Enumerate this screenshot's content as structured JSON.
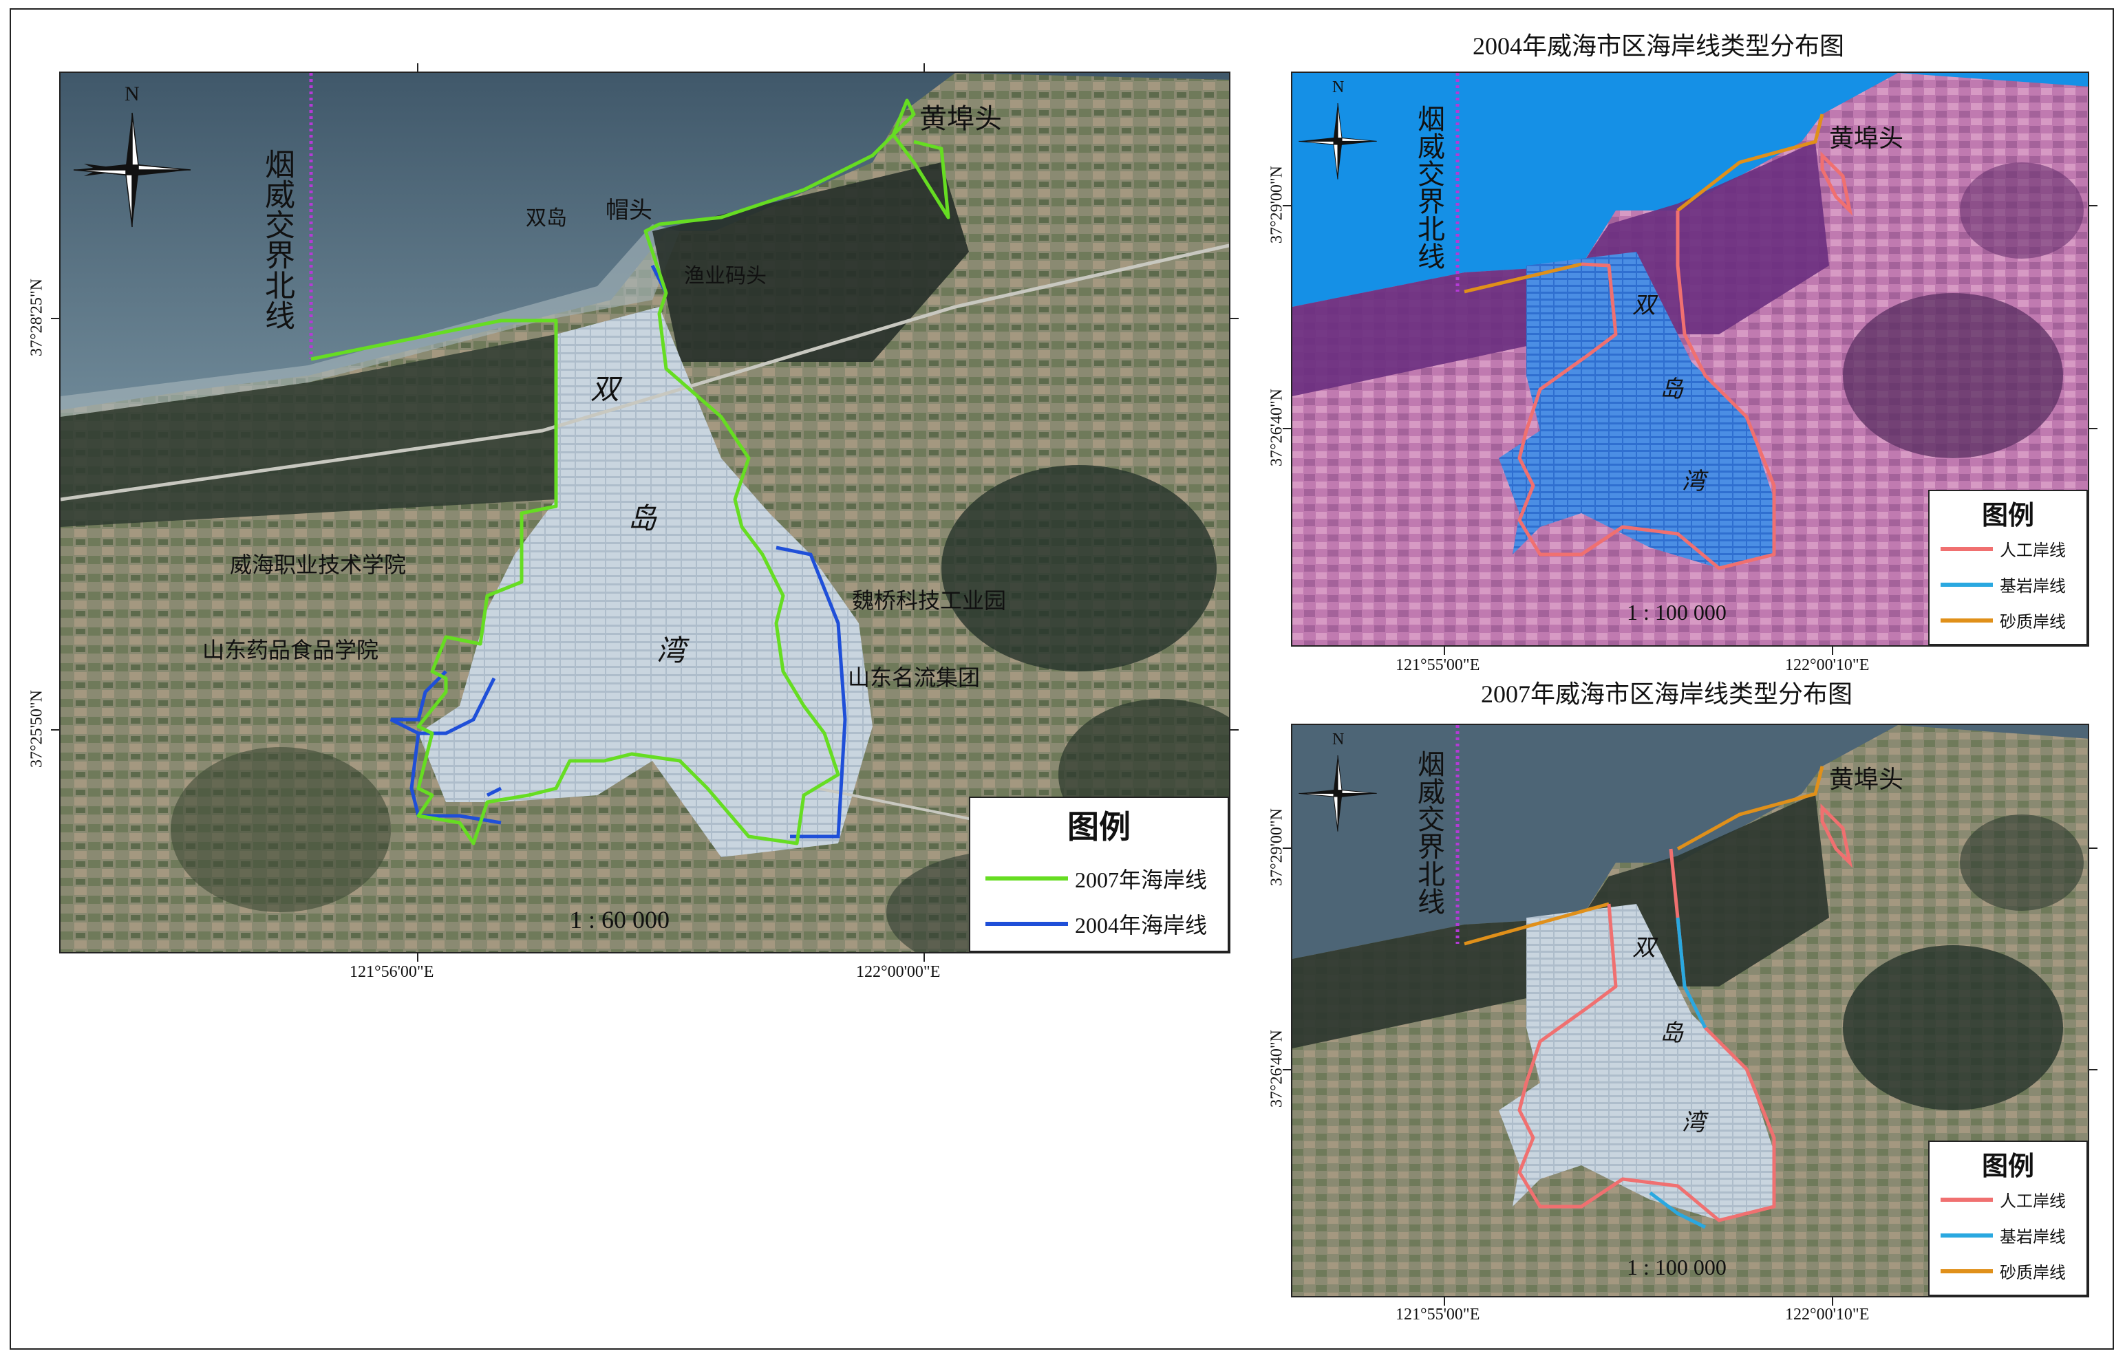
{
  "main_map": {
    "place_labels": {
      "huangbutou": "黄埠头",
      "shuangdao": "双岛",
      "maotou": "帽头",
      "yuye_matou": "渔业码头",
      "zhiye_xueyuan": "威海职业技术学院",
      "yaopin_xueyuan": "山东药品食品学院",
      "weiqiao": "魏桥科技工业园",
      "mingliu": "山东名流集团",
      "bay_char_1": "双",
      "bay_char_2": "岛",
      "bay_char_3": "湾"
    },
    "boundary_label": "烟威交界北线",
    "north_label": "N",
    "scale": "1 : 60 000",
    "legend": {
      "title": "图例",
      "items": [
        {
          "label": "2007年海岸线",
          "color": "#66dd22"
        },
        {
          "label": "2004年海岸线",
          "color": "#1f4fd8"
        }
      ]
    },
    "lat_labels": [
      "37°28'25\"N",
      "37°25'50\"N"
    ],
    "lon_labels": [
      "121°56'00\"E",
      "122°00'00\"E"
    ]
  },
  "map_2004": {
    "title": "2004年威海市区海岸线类型分布图",
    "place_labels": {
      "huangbutou": "黄埠头",
      "bay_char_1": "双",
      "bay_char_2": "岛",
      "bay_char_3": "湾"
    },
    "boundary_label": "烟威交界北线",
    "north_label": "N",
    "scale": "1 : 100 000",
    "legend": {
      "title": "图例",
      "items": [
        {
          "label": "人工岸线",
          "color": "#f07070"
        },
        {
          "label": "基岩岸线",
          "color": "#2aa8e0"
        },
        {
          "label": "砂质岸线",
          "color": "#e0901a"
        }
      ]
    },
    "lat_labels": [
      "37°29'00\"N",
      "37°26'40\"N"
    ],
    "lon_labels": [
      "121°55'00\"E",
      "122°00'10\"E"
    ]
  },
  "map_2007": {
    "title": "2007年威海市区海岸线类型分布图",
    "place_labels": {
      "huangbutou": "黄埠头",
      "bay_char_1": "双",
      "bay_char_2": "岛",
      "bay_char_3": "湾"
    },
    "boundary_label": "烟威交界北线",
    "north_label": "N",
    "scale": "1 : 100 000",
    "legend": {
      "title": "图例",
      "items": [
        {
          "label": "人工岸线",
          "color": "#f07070"
        },
        {
          "label": "基岩岸线",
          "color": "#2aa8e0"
        },
        {
          "label": "砂质岸线",
          "color": "#e0901a"
        }
      ]
    },
    "lat_labels": [
      "37°29'00\"N",
      "37°26'40\"N"
    ],
    "lon_labels": [
      "121°55'00\"E",
      "122°00'10\"E"
    ]
  }
}
